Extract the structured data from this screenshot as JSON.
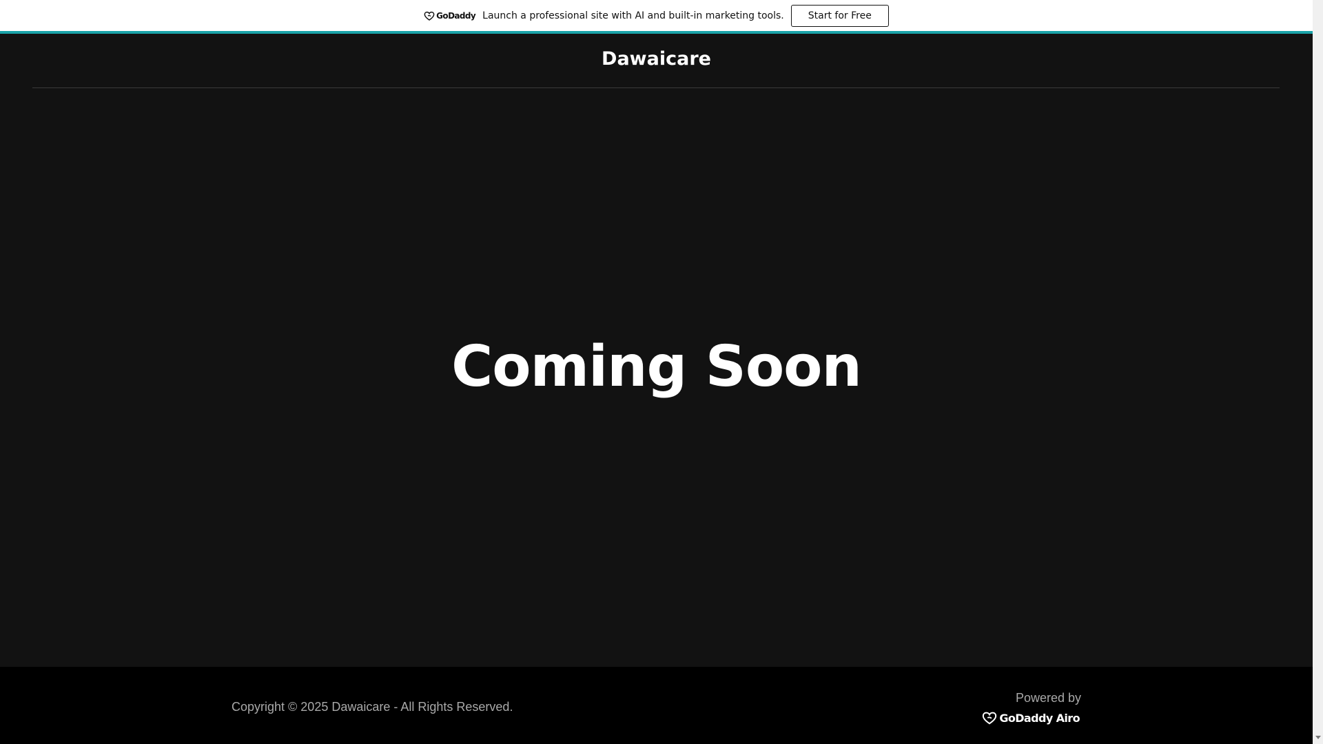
{
  "banner": {
    "brand": "GoDaddy",
    "text": "Launch a professional site with AI and built-in marketing tools.",
    "button_label": "Start for Free",
    "accent": "#1aa3a8"
  },
  "header": {
    "site_title": "Dawaicare"
  },
  "hero": {
    "title": "Coming Soon"
  },
  "footer": {
    "copyright": "Copyright © 2025 Dawaicare - All Rights Reserved.",
    "powered_by": "Powered by",
    "logo_text": "GoDaddy Airo",
    "logo_icon": "godaddy-heart-icon"
  },
  "scrollbar": {
    "arrow_icon": "chevron-down-icon"
  }
}
